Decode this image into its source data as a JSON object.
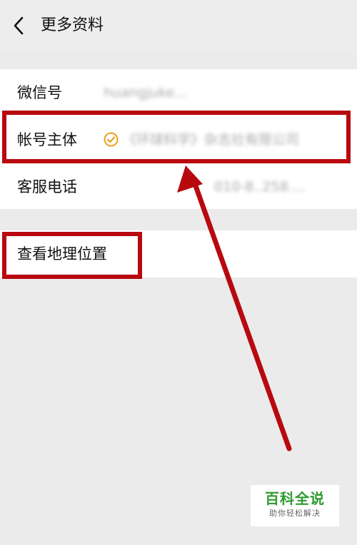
{
  "header": {
    "back_icon": "chevron-left-icon",
    "title": "更多资料"
  },
  "info_rows": [
    {
      "label": "微信号",
      "value": "huangjuke..."
    },
    {
      "label": "帐号主体",
      "value": "《环球科学》杂志社有限公司",
      "verified_icon": "verified-check-icon"
    },
    {
      "label": "客服电话",
      "value": "010-8..258...."
    }
  ],
  "location_row": {
    "label": "查看地理位置"
  },
  "annotation": {
    "color": "#b8090f",
    "arrow": "pointing to 帐号主体 row"
  },
  "watermark": {
    "main": "百科全说",
    "sub": "助你轻松解决",
    "color": "#2f9a2f"
  }
}
